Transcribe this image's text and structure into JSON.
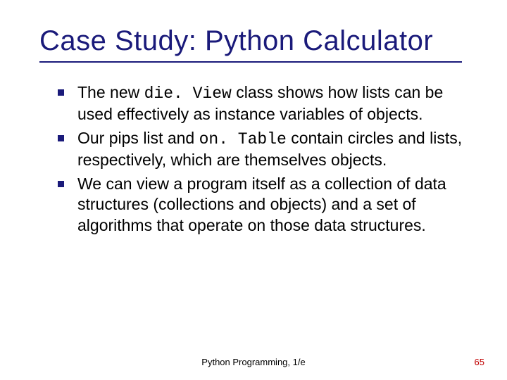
{
  "title": "Case Study: Python Calculator",
  "bullets": [
    {
      "pre": "The new ",
      "code": "die. View",
      "post": " class shows how lists can be used effectively as instance variables of objects."
    },
    {
      "pre": "Our pips list and ",
      "code": "on. Table",
      "post": " contain circles and lists, respectively, which are themselves objects."
    },
    {
      "pre": "We can view a program itself as a collection of data structures (collections and objects) and a set of algorithms that operate on those data structures.",
      "code": "",
      "post": ""
    }
  ],
  "footer_center": "Python Programming, 1/e",
  "footer_right": "65"
}
